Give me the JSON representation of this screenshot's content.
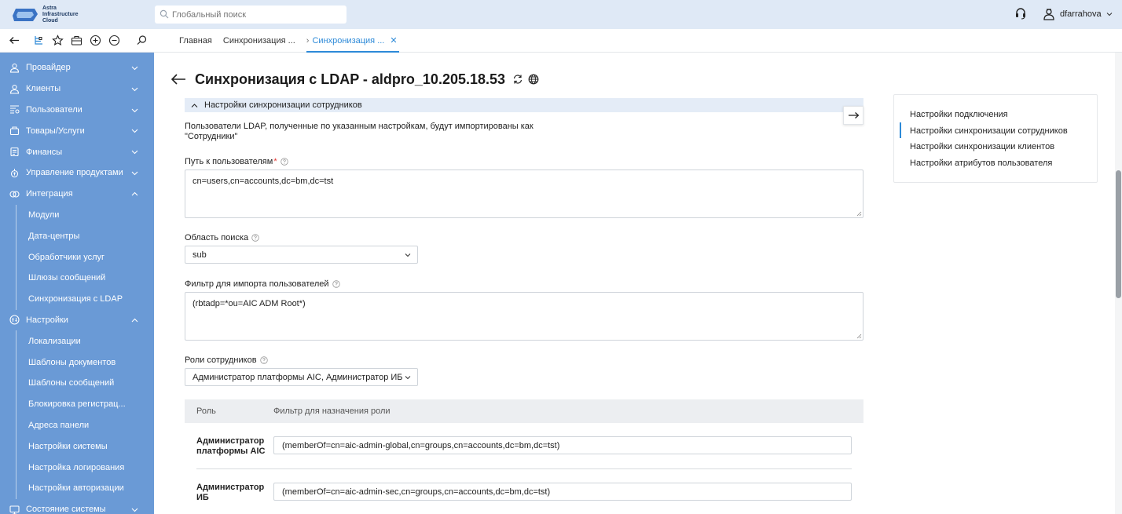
{
  "app": {
    "logo_line1": "Astra",
    "logo_line2": "Infrastructure",
    "logo_line3": "Cloud"
  },
  "search": {
    "placeholder": "Глобальный поиск"
  },
  "user": {
    "name": "dfarrahova"
  },
  "tabs": [
    {
      "label": "Главная"
    },
    {
      "label": "Синхронизация ..."
    },
    {
      "label": "Синхронизация ..."
    }
  ],
  "sidebar": {
    "items": [
      {
        "label": "Провайдер",
        "icon": "provider-icon"
      },
      {
        "label": "Клиенты",
        "icon": "clients-icon"
      },
      {
        "label": "Пользователи",
        "icon": "users-icon"
      },
      {
        "label": "Товары/Услуги",
        "icon": "cart-icon"
      },
      {
        "label": "Финансы",
        "icon": "finance-icon"
      },
      {
        "label": "Управление продуктами",
        "icon": "products-icon"
      },
      {
        "label": "Интеграция",
        "icon": "integration-icon"
      }
    ],
    "integration_sub": [
      "Модули",
      "Дата-центры",
      "Обработчики услуг",
      "Шлюзы сообщений",
      "Синхронизация с LDAP"
    ],
    "settings": {
      "label": "Настройки",
      "icon": "settings-icon"
    },
    "settings_sub": [
      "Локализации",
      "Шаблоны документов",
      "Шаблоны сообщений",
      "Блокировка регистрац...",
      "Адреса панели",
      "Настройки системы",
      "Настройка логирования",
      "Настройки авторизации"
    ],
    "system_state": {
      "label": "Состояние системы",
      "icon": "monitor-icon"
    }
  },
  "page": {
    "title": "Синхронизация с LDAP - aldpro_10.205.18.53"
  },
  "section": {
    "title": "Настройки синхронизации сотрудников",
    "description_line1": "Пользователи LDAP, полученные по указанным настройкам, будут импортированы как",
    "description_line2": "\"Сотрудники\""
  },
  "fields": {
    "users_path_label": "Путь к пользователям",
    "users_path_required": "*",
    "users_path_value": "cn=users,cn=accounts,dc=bm,dc=tst",
    "search_scope_label": "Область поиска",
    "search_scope_value": "sub",
    "import_filter_label": "Фильтр для импорта пользователей",
    "import_filter_value": "(rbtadp=*ou=AIC ADM Root*)",
    "roles_label": "Роли сотрудников",
    "roles_value": "Администратор платформы AIC,  Администратор ИБ"
  },
  "roles_table": {
    "col_role": "Роль",
    "col_filter": "Фильтр для назначения роли",
    "rows": [
      {
        "role_line1": "Администратор",
        "role_line2": "платформы AIC",
        "filter": "(memberOf=cn=aic-admin-global,cn=groups,cn=accounts,dc=bm,dc=tst)"
      },
      {
        "role_line1": "Администратор",
        "role_line2": "ИБ",
        "filter": "(memberOf=cn=aic-admin-sec,cn=groups,cn=accounts,dc=bm,dc=tst)"
      }
    ]
  },
  "toc": {
    "items": [
      "Настройки подключения",
      "Настройки синхронизации сотрудников",
      "Настройки синхронизации клиентов",
      "Настройки атрибутов пользователя"
    ],
    "active_index": 1
  },
  "colors": {
    "sidebar_bg": "#6a9ad6",
    "topbar_bg": "#dfe9f6",
    "accent": "#2d8ad8",
    "section_head_bg": "#e4ecf7"
  }
}
